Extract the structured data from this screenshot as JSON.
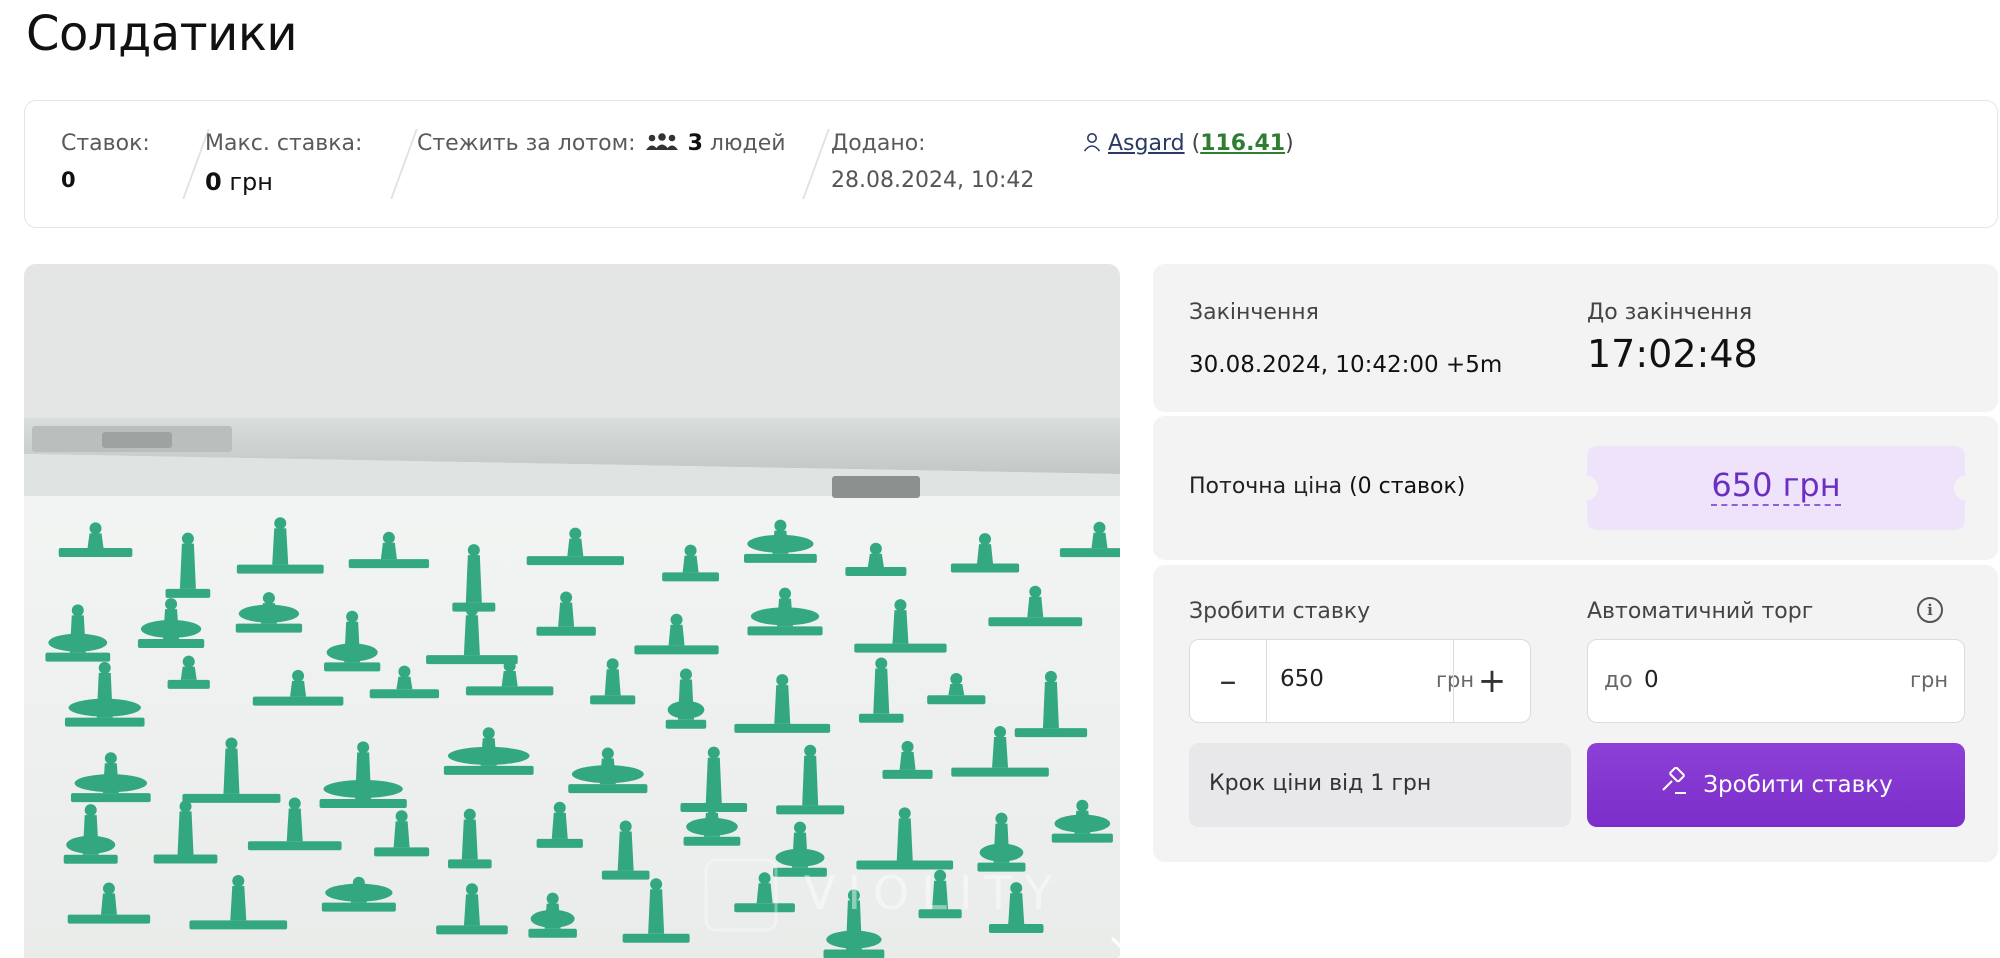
{
  "page": {
    "title": "Солдатики"
  },
  "lot_info": {
    "bids_label": "Ставок:",
    "bids_value": "0",
    "max_bid_label": "Макс. ставка:",
    "max_bid_amount": "0",
    "max_bid_currency": "грн",
    "watchers_label": "Стежить за лотом:",
    "watchers_icon": "people-icon",
    "watchers_count": "3",
    "watchers_suffix": "людей",
    "added_label": "Додано:",
    "added_value": "28.08.2024, 10:42",
    "seller_icon": "user-icon",
    "seller_name": "Asgard",
    "seller_rating": "116.41"
  },
  "photo": {
    "watermark": "VIOLITY",
    "next_icon": "chevron-right-icon"
  },
  "end_panel": {
    "end_label": "Закінчення",
    "end_value": "30.08.2024, 10:42:00 +5m",
    "countdown_label": "До закінчення",
    "countdown_value": "17:02:48"
  },
  "price_panel": {
    "label_prefix": "Поточна ціна",
    "label_bids": "(0 ставок)",
    "price": "650 грн",
    "accent_color": "#6a2fc0"
  },
  "bid_panel": {
    "make_bid_label": "Зробити ставку",
    "bid_value": "650",
    "bid_unit": "грн",
    "minus_icon": "minus-icon",
    "plus_icon": "plus-icon",
    "auto_label": "Автоматичний торг",
    "info_icon": "info-icon",
    "auto_prefix": "до",
    "auto_value": "0",
    "auto_unit": "грн",
    "step_hint": "Крок ціни від 1 грн",
    "submit_label": "Зробити ставку",
    "submit_icon": "gavel-icon",
    "button_color": "#7b2ec9"
  }
}
